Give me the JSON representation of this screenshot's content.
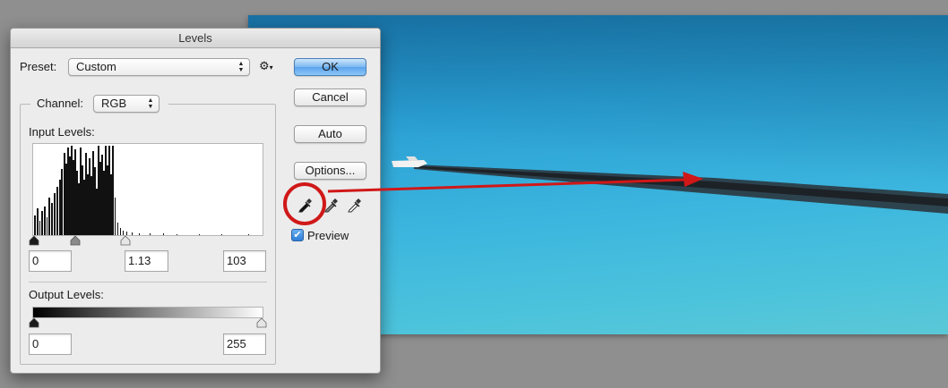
{
  "dialog": {
    "title": "Levels",
    "preset_label": "Preset:",
    "preset_value": "Custom",
    "channel_label": "Channel:",
    "channel_value": "RGB",
    "input_levels_label": "Input Levels:",
    "output_levels_label": "Output Levels:",
    "input_black": "0",
    "input_gamma": "1.13",
    "input_white": "103",
    "output_black": "0",
    "output_white": "255",
    "buttons": {
      "ok": "OK",
      "cancel": "Cancel",
      "auto": "Auto",
      "options": "Options..."
    },
    "preview_label": "Preview",
    "preview_checked": true,
    "gear_icon": "gear-icon",
    "eyedroppers": [
      "black-eyedropper-icon",
      "gray-eyedropper-icon",
      "white-eyedropper-icon"
    ]
  },
  "colors": {
    "accent_blue": "#5ba4ec",
    "annotation_red": "#d01818",
    "sky": "#2a9fd4"
  }
}
